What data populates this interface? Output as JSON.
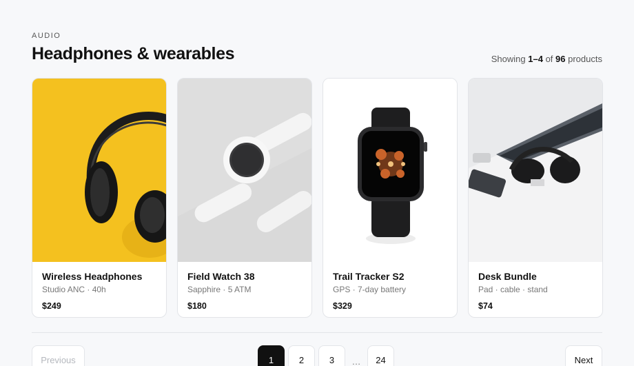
{
  "header": {
    "eyebrow": "AUDIO",
    "title": "Headphones & wearables",
    "count_prefix": "Showing",
    "count_range": "1–4",
    "count_of": "of",
    "count_total": "96",
    "count_suffix": "products"
  },
  "products": [
    {
      "name": "Wireless Headphones",
      "meta": "Studio ANC · 40h",
      "price": "$249",
      "image": "headphones-image"
    },
    {
      "name": "Field Watch 38",
      "meta": "Sapphire · 5 ATM",
      "price": "$180",
      "image": "white-watch-image"
    },
    {
      "name": "Trail Tracker S2",
      "meta": "GPS · 7-day battery",
      "price": "$329",
      "image": "smartwatch-image"
    },
    {
      "name": "Desk Bundle",
      "meta": "Pad · cable · stand",
      "price": "$74",
      "image": "desk-setup-image"
    }
  ],
  "pagination": {
    "previous": "Previous",
    "next": "Next",
    "pages": [
      "1",
      "2",
      "3"
    ],
    "ellipsis": "…",
    "last": "24",
    "current": "1"
  }
}
